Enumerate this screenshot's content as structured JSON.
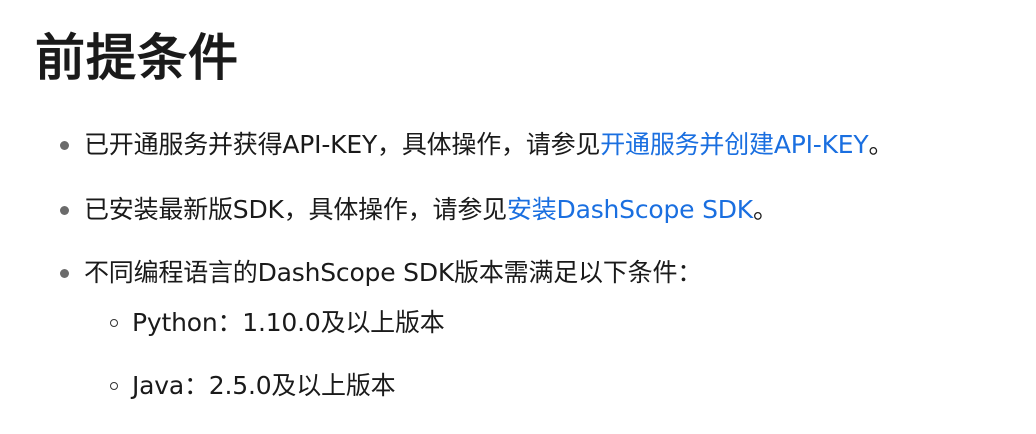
{
  "title": "前提条件",
  "items": [
    {
      "prefix": "已开通服务并获得API-KEY，具体操作，请参见",
      "link": "开通服务并创建API-KEY",
      "suffix": "。"
    },
    {
      "prefix": "已安装最新版SDK，具体操作，请参见",
      "link": "安装DashScope SDK",
      "suffix": "。"
    },
    {
      "text": "不同编程语言的DashScope SDK版本需满足以下条件：",
      "subitems": [
        "Python：1.10.0及以上版本",
        "Java：2.5.0及以上版本"
      ]
    }
  ],
  "colors": {
    "text": "#1a1a1a",
    "link": "#1a6fe0",
    "bullet": "#6b6b6b"
  }
}
